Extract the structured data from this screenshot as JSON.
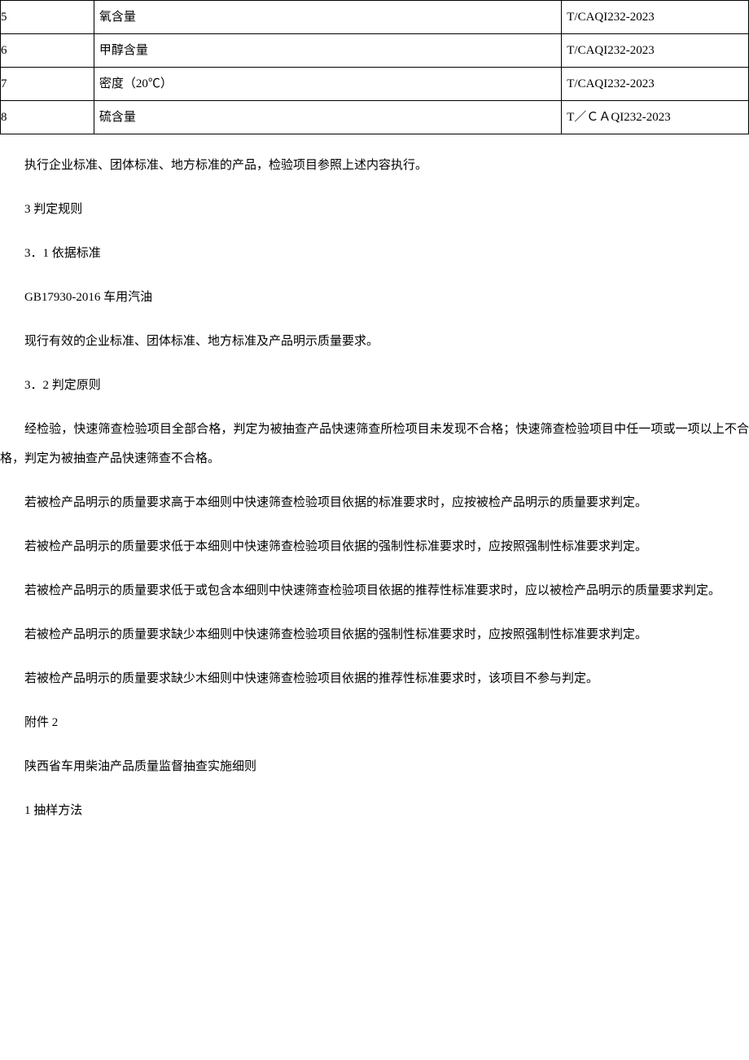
{
  "table": {
    "rows": [
      {
        "num": "5",
        "item": "氧含量",
        "standard": "T/CAQI232-2023"
      },
      {
        "num": "6",
        "item": "甲醇含量",
        "standard": "T/CAQI232-2023"
      },
      {
        "num": "7",
        "item": "密度（20℃）",
        "standard": "T/CAQI232-2023"
      },
      {
        "num": "8",
        "item": "硫含量",
        "standard": "T／ＣＡQI232-2023"
      }
    ]
  },
  "paragraphs": {
    "p1": "执行企业标准、团体标准、地方标准的产品，检验项目参照上述内容执行。",
    "p2": "3 判定规则",
    "p3": "3．1 依据标准",
    "p4": "GB17930-2016 车用汽油",
    "p5": "现行有效的企业标准、团体标准、地方标准及产品明示质量要求。",
    "p6": "3．2 判定原则",
    "p7": "经检验，快速筛查检验项目全部合格，判定为被抽查产品快速筛查所检项目未发现不合格；快速筛查检验项目中任一项或一项以上不合格，判定为被抽查产品快速筛查不合格。",
    "p8": "若被检产品明示的质量要求高于本细则中快速筛查检验项目依据的标准要求时，应按被检产品明示的质量要求判定。",
    "p9": "若被检产品明示的质量要求低于本细则中快速筛查检验项目依据的强制性标准要求时，应按照强制性标准要求判定。",
    "p10": "若被检产品明示的质量要求低于或包含本细则中快速筛查检验项目依据的推荐性标准要求时，应以被检产品明示的质量要求判定。",
    "p11": "若被检产品明示的质量要求缺少本细则中快速筛查检验项目依据的强制性标准要求时，应按照强制性标准要求判定。",
    "p12": "若被检产品明示的质量要求缺少木细则中快速筛查检验项目依据的推荐性标准要求时，该项目不参与判定。",
    "p13": "附件 2",
    "p14": "陕西省车用柴油产品质量监督抽查实施细则",
    "p15": "1 抽样方法"
  }
}
